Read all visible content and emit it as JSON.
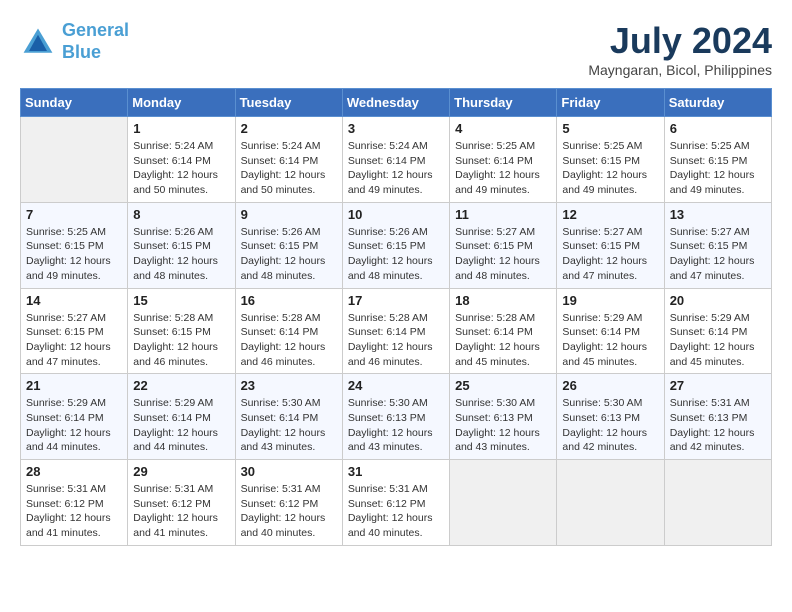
{
  "header": {
    "logo_line1": "General",
    "logo_line2": "Blue",
    "month": "July 2024",
    "location": "Mayngaran, Bicol, Philippines"
  },
  "days_of_week": [
    "Sunday",
    "Monday",
    "Tuesday",
    "Wednesday",
    "Thursday",
    "Friday",
    "Saturday"
  ],
  "weeks": [
    [
      {
        "day": "",
        "sunrise": "",
        "sunset": "",
        "daylight": ""
      },
      {
        "day": "1",
        "sunrise": "Sunrise: 5:24 AM",
        "sunset": "Sunset: 6:14 PM",
        "daylight": "Daylight: 12 hours and 50 minutes."
      },
      {
        "day": "2",
        "sunrise": "Sunrise: 5:24 AM",
        "sunset": "Sunset: 6:14 PM",
        "daylight": "Daylight: 12 hours and 50 minutes."
      },
      {
        "day": "3",
        "sunrise": "Sunrise: 5:24 AM",
        "sunset": "Sunset: 6:14 PM",
        "daylight": "Daylight: 12 hours and 49 minutes."
      },
      {
        "day": "4",
        "sunrise": "Sunrise: 5:25 AM",
        "sunset": "Sunset: 6:14 PM",
        "daylight": "Daylight: 12 hours and 49 minutes."
      },
      {
        "day": "5",
        "sunrise": "Sunrise: 5:25 AM",
        "sunset": "Sunset: 6:15 PM",
        "daylight": "Daylight: 12 hours and 49 minutes."
      },
      {
        "day": "6",
        "sunrise": "Sunrise: 5:25 AM",
        "sunset": "Sunset: 6:15 PM",
        "daylight": "Daylight: 12 hours and 49 minutes."
      }
    ],
    [
      {
        "day": "7",
        "sunrise": "Sunrise: 5:25 AM",
        "sunset": "Sunset: 6:15 PM",
        "daylight": "Daylight: 12 hours and 49 minutes."
      },
      {
        "day": "8",
        "sunrise": "Sunrise: 5:26 AM",
        "sunset": "Sunset: 6:15 PM",
        "daylight": "Daylight: 12 hours and 48 minutes."
      },
      {
        "day": "9",
        "sunrise": "Sunrise: 5:26 AM",
        "sunset": "Sunset: 6:15 PM",
        "daylight": "Daylight: 12 hours and 48 minutes."
      },
      {
        "day": "10",
        "sunrise": "Sunrise: 5:26 AM",
        "sunset": "Sunset: 6:15 PM",
        "daylight": "Daylight: 12 hours and 48 minutes."
      },
      {
        "day": "11",
        "sunrise": "Sunrise: 5:27 AM",
        "sunset": "Sunset: 6:15 PM",
        "daylight": "Daylight: 12 hours and 48 minutes."
      },
      {
        "day": "12",
        "sunrise": "Sunrise: 5:27 AM",
        "sunset": "Sunset: 6:15 PM",
        "daylight": "Daylight: 12 hours and 47 minutes."
      },
      {
        "day": "13",
        "sunrise": "Sunrise: 5:27 AM",
        "sunset": "Sunset: 6:15 PM",
        "daylight": "Daylight: 12 hours and 47 minutes."
      }
    ],
    [
      {
        "day": "14",
        "sunrise": "Sunrise: 5:27 AM",
        "sunset": "Sunset: 6:15 PM",
        "daylight": "Daylight: 12 hours and 47 minutes."
      },
      {
        "day": "15",
        "sunrise": "Sunrise: 5:28 AM",
        "sunset": "Sunset: 6:15 PM",
        "daylight": "Daylight: 12 hours and 46 minutes."
      },
      {
        "day": "16",
        "sunrise": "Sunrise: 5:28 AM",
        "sunset": "Sunset: 6:14 PM",
        "daylight": "Daylight: 12 hours and 46 minutes."
      },
      {
        "day": "17",
        "sunrise": "Sunrise: 5:28 AM",
        "sunset": "Sunset: 6:14 PM",
        "daylight": "Daylight: 12 hours and 46 minutes."
      },
      {
        "day": "18",
        "sunrise": "Sunrise: 5:28 AM",
        "sunset": "Sunset: 6:14 PM",
        "daylight": "Daylight: 12 hours and 45 minutes."
      },
      {
        "day": "19",
        "sunrise": "Sunrise: 5:29 AM",
        "sunset": "Sunset: 6:14 PM",
        "daylight": "Daylight: 12 hours and 45 minutes."
      },
      {
        "day": "20",
        "sunrise": "Sunrise: 5:29 AM",
        "sunset": "Sunset: 6:14 PM",
        "daylight": "Daylight: 12 hours and 45 minutes."
      }
    ],
    [
      {
        "day": "21",
        "sunrise": "Sunrise: 5:29 AM",
        "sunset": "Sunset: 6:14 PM",
        "daylight": "Daylight: 12 hours and 44 minutes."
      },
      {
        "day": "22",
        "sunrise": "Sunrise: 5:29 AM",
        "sunset": "Sunset: 6:14 PM",
        "daylight": "Daylight: 12 hours and 44 minutes."
      },
      {
        "day": "23",
        "sunrise": "Sunrise: 5:30 AM",
        "sunset": "Sunset: 6:14 PM",
        "daylight": "Daylight: 12 hours and 43 minutes."
      },
      {
        "day": "24",
        "sunrise": "Sunrise: 5:30 AM",
        "sunset": "Sunset: 6:13 PM",
        "daylight": "Daylight: 12 hours and 43 minutes."
      },
      {
        "day": "25",
        "sunrise": "Sunrise: 5:30 AM",
        "sunset": "Sunset: 6:13 PM",
        "daylight": "Daylight: 12 hours and 43 minutes."
      },
      {
        "day": "26",
        "sunrise": "Sunrise: 5:30 AM",
        "sunset": "Sunset: 6:13 PM",
        "daylight": "Daylight: 12 hours and 42 minutes."
      },
      {
        "day": "27",
        "sunrise": "Sunrise: 5:31 AM",
        "sunset": "Sunset: 6:13 PM",
        "daylight": "Daylight: 12 hours and 42 minutes."
      }
    ],
    [
      {
        "day": "28",
        "sunrise": "Sunrise: 5:31 AM",
        "sunset": "Sunset: 6:12 PM",
        "daylight": "Daylight: 12 hours and 41 minutes."
      },
      {
        "day": "29",
        "sunrise": "Sunrise: 5:31 AM",
        "sunset": "Sunset: 6:12 PM",
        "daylight": "Daylight: 12 hours and 41 minutes."
      },
      {
        "day": "30",
        "sunrise": "Sunrise: 5:31 AM",
        "sunset": "Sunset: 6:12 PM",
        "daylight": "Daylight: 12 hours and 40 minutes."
      },
      {
        "day": "31",
        "sunrise": "Sunrise: 5:31 AM",
        "sunset": "Sunset: 6:12 PM",
        "daylight": "Daylight: 12 hours and 40 minutes."
      },
      {
        "day": "",
        "sunrise": "",
        "sunset": "",
        "daylight": ""
      },
      {
        "day": "",
        "sunrise": "",
        "sunset": "",
        "daylight": ""
      },
      {
        "day": "",
        "sunrise": "",
        "sunset": "",
        "daylight": ""
      }
    ]
  ]
}
